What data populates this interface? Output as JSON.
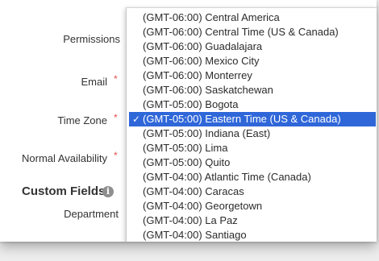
{
  "form": {
    "labels": {
      "permissions": "Permissions",
      "email": "Email",
      "time_zone": "Time Zone",
      "normal_availability": "Normal Availability",
      "department": "Department"
    },
    "required_marker": "*",
    "custom_fields_title": "Custom Fields",
    "info_icon_glyph": "i"
  },
  "time_zone_dropdown": {
    "selected_index": 7,
    "check_glyph": "✓",
    "options": [
      "(GMT-06:00) Central America",
      "(GMT-06:00) Central Time (US & Canada)",
      "(GMT-06:00) Guadalajara",
      "(GMT-06:00) Mexico City",
      "(GMT-06:00) Monterrey",
      "(GMT-06:00) Saskatchewan",
      "(GMT-05:00) Bogota",
      "(GMT-05:00) Eastern Time (US & Canada)",
      "(GMT-05:00) Indiana (East)",
      "(GMT-05:00) Lima",
      "(GMT-05:00) Quito",
      "(GMT-04:00) Atlantic Time (Canada)",
      "(GMT-04:00) Caracas",
      "(GMT-04:00) Georgetown",
      "(GMT-04:00) La Paz",
      "(GMT-04:00) Santiago"
    ]
  },
  "colors": {
    "selection": "#2f67d9",
    "required": "#e0504a"
  }
}
